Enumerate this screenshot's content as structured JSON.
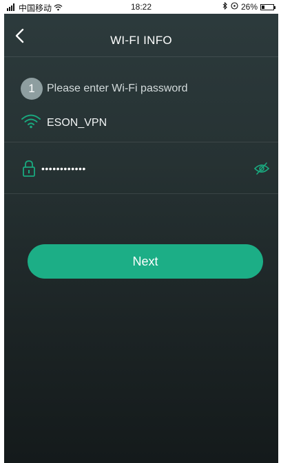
{
  "status_bar": {
    "carrier": "中国移动",
    "time": "18:22",
    "battery_percent": "26%",
    "battery_level": 0.26,
    "icons": [
      "signal-icon",
      "wifi-signal-icon",
      "bluetooth-icon",
      "location-icon",
      "battery-icon"
    ]
  },
  "header": {
    "title": "WI-FI INFO",
    "back_icon": "chevron-left-icon"
  },
  "step": {
    "number": "1",
    "text": "Please enter Wi-Fi password"
  },
  "wifi": {
    "icon": "wifi-icon",
    "ssid": "ESON_VPN"
  },
  "password": {
    "icon": "lock-icon",
    "value": "••••••••••••",
    "visibility_icon": "eye-slash-icon"
  },
  "actions": {
    "next_label": "Next"
  },
  "colors": {
    "accent": "#1cae86",
    "icon_green": "#1aa97f",
    "step_circle": "#8e9ea0",
    "background_top": "#2d3b3d",
    "background_bottom": "#141a1b"
  }
}
